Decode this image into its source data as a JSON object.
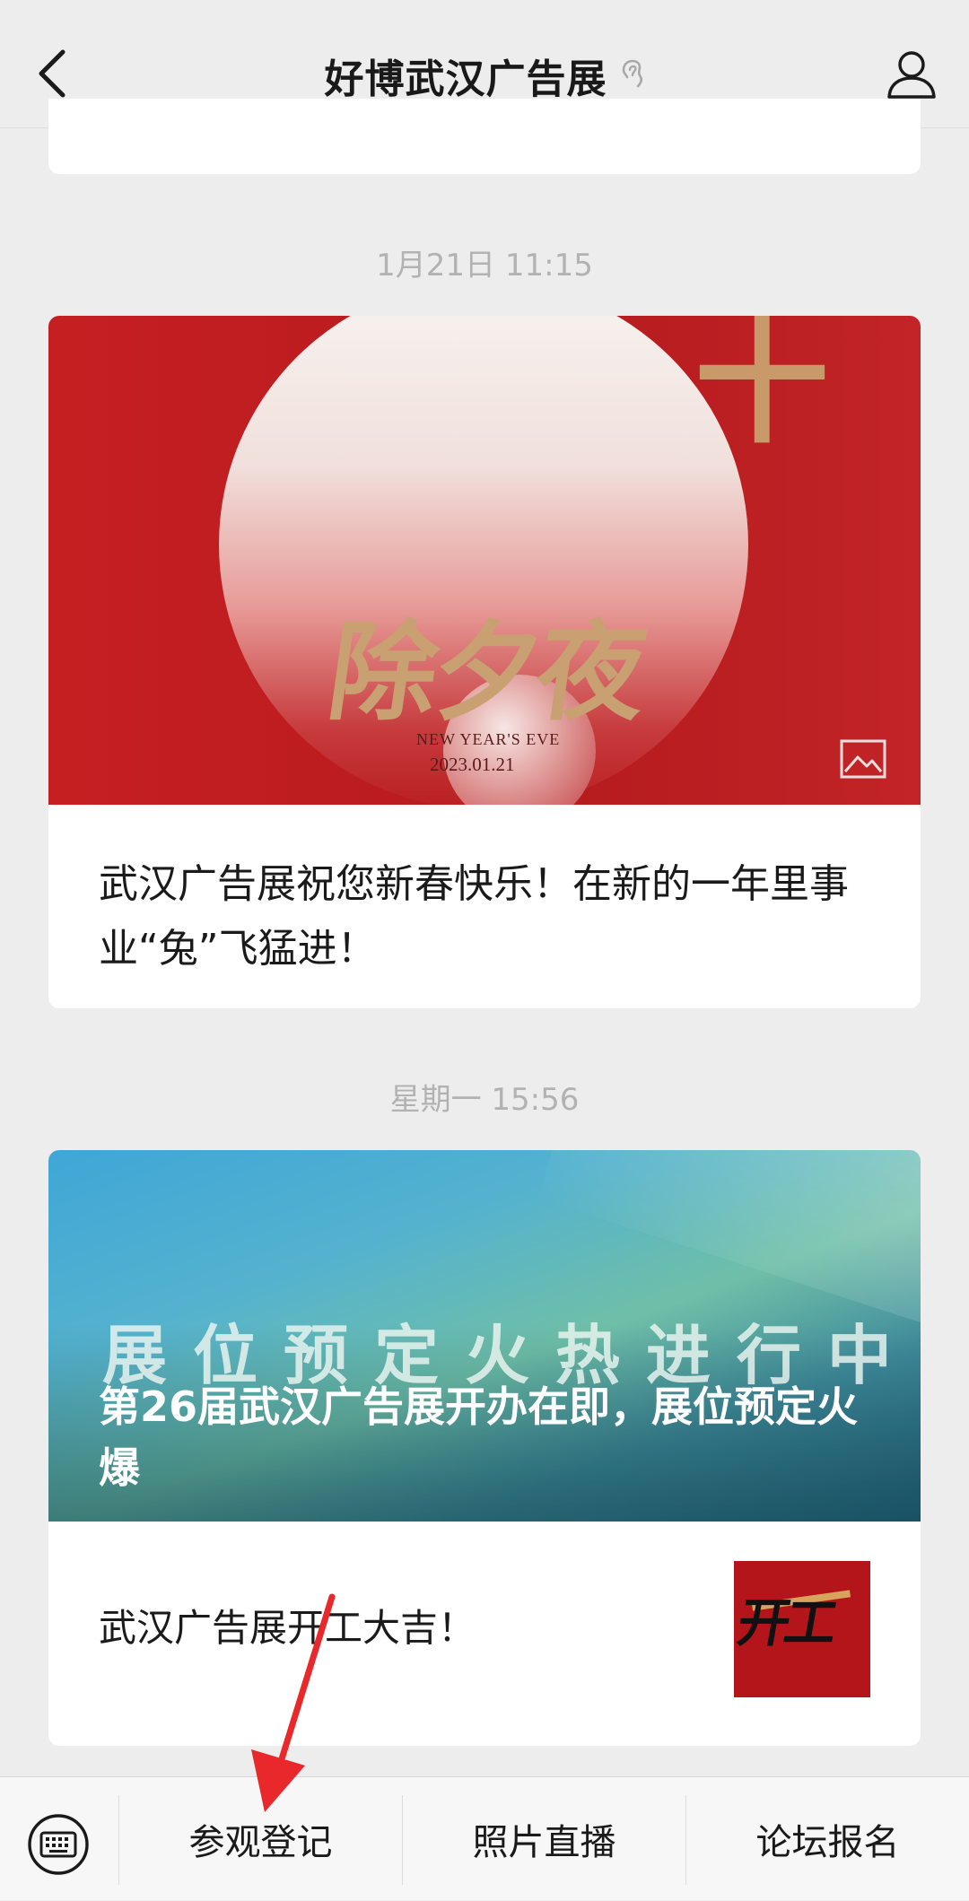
{
  "header": {
    "title": "好博武汉广告展",
    "back_icon": "chevron-left-icon",
    "ear_icon": "ear-icon",
    "profile_icon": "person-icon"
  },
  "messages": [
    {
      "timestamp": "1月21日 11:15",
      "cover": {
        "calligraphy": "除夕夜",
        "subtitle": "NEW YEAR'S EVE",
        "date": "2023.01.21",
        "gold_char": "十"
      },
      "title": "武汉广告展祝您新春快乐！在新的一年里事业“兔”飞猛进！"
    },
    {
      "timestamp": "星期一 15:56",
      "cover": {
        "banner": [
          "展",
          "位",
          "预",
          "定",
          "火",
          "热",
          "进",
          "行",
          "中"
        ],
        "headline": "第26届武汉广告展开办在即，展位预定火爆"
      },
      "sub_item": {
        "title": "武汉广告展开工大吉！",
        "thumb_text": "开工"
      }
    }
  ],
  "bottom_menu": {
    "keyboard_icon": "keyboard-icon",
    "items": [
      "参观登记",
      "照片直播",
      "论坛报名"
    ]
  },
  "colors": {
    "background": "#ededed",
    "timestamp": "#b2b2b2",
    "annotation_arrow": "#e8282b"
  }
}
